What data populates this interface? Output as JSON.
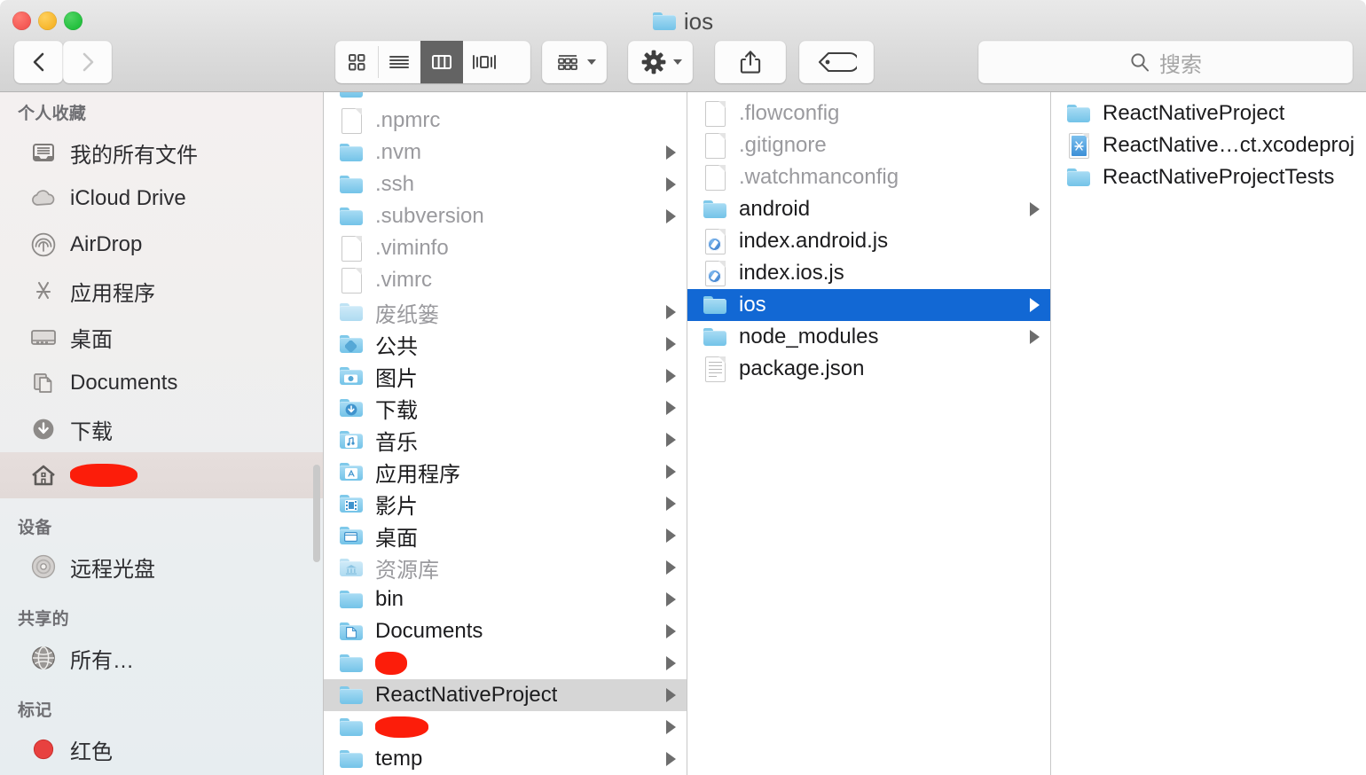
{
  "window": {
    "title": "ios",
    "title_icon": "folder-icon",
    "traffic_lights": [
      {
        "name": "close-button",
        "color": "#f35753"
      },
      {
        "name": "minimize-button",
        "color": "#f6b52b"
      },
      {
        "name": "maximize-button",
        "color": "#23bf3d"
      }
    ]
  },
  "toolbar": {
    "back_label": "‹",
    "forward_label": "›",
    "view_modes": [
      {
        "name": "icon-view-button",
        "icon": "grid-icon",
        "active": false
      },
      {
        "name": "list-view-button",
        "icon": "list-icon",
        "active": false
      },
      {
        "name": "column-view-button",
        "icon": "columns-icon",
        "active": true
      },
      {
        "name": "gallery-view-button",
        "icon": "coverflow-icon",
        "active": false
      }
    ],
    "arrange_label": "arrange-icon",
    "action_label": "gear-icon",
    "share_label": "share-icon",
    "tags_label": "tag-icon"
  },
  "search": {
    "placeholder": "搜索",
    "value": "",
    "icon": "search-icon"
  },
  "sidebar": {
    "sections": [
      {
        "header": "个人收藏",
        "items": [
          {
            "label": "我的所有文件",
            "icon": "all-my-files-icon",
            "selected": false,
            "redacted": false
          },
          {
            "label": "iCloud Drive",
            "icon": "icloud-icon",
            "selected": false,
            "redacted": false
          },
          {
            "label": "AirDrop",
            "icon": "airdrop-icon",
            "selected": false,
            "redacted": false
          },
          {
            "label": "应用程序",
            "icon": "applications-icon",
            "selected": false,
            "redacted": false
          },
          {
            "label": "桌面",
            "icon": "desktop-icon",
            "selected": false,
            "redacted": false
          },
          {
            "label": "Documents",
            "icon": "documents-icon",
            "selected": false,
            "redacted": false
          },
          {
            "label": "下载",
            "icon": "downloads-icon",
            "selected": false,
            "redacted": false
          },
          {
            "label": "",
            "icon": "home-icon",
            "selected": true,
            "redacted": true
          }
        ]
      },
      {
        "header": "设备",
        "items": [
          {
            "label": "远程光盘",
            "icon": "remote-disc-icon",
            "selected": false,
            "redacted": false
          }
        ]
      },
      {
        "header": "共享的",
        "items": [
          {
            "label": "所有…",
            "icon": "network-globe-icon",
            "selected": false,
            "redacted": false
          }
        ]
      },
      {
        "header": "标记",
        "items": [
          {
            "label": "红色",
            "icon": "red-tag-icon",
            "selected": false,
            "redacted": false,
            "color": "#e8413f"
          }
        ]
      }
    ]
  },
  "columns": [
    {
      "name": "home-column",
      "cut_top_row": {
        "label": "",
        "icon": "folder-icon"
      },
      "rows": [
        {
          "label": ".npmrc",
          "icon": "doc-icon",
          "dim": true,
          "arrow": false,
          "state": "none"
        },
        {
          "label": ".nvm",
          "icon": "folder-icon",
          "dim": true,
          "arrow": true,
          "state": "none"
        },
        {
          "label": ".ssh",
          "icon": "folder-icon",
          "dim": true,
          "arrow": true,
          "state": "none"
        },
        {
          "label": ".subversion",
          "icon": "folder-icon",
          "dim": true,
          "arrow": true,
          "state": "none"
        },
        {
          "label": ".viminfo",
          "icon": "doc-icon",
          "dim": true,
          "arrow": false,
          "state": "none"
        },
        {
          "label": ".vimrc",
          "icon": "doc-icon",
          "dim": true,
          "arrow": false,
          "state": "none"
        },
        {
          "label": "废纸篓",
          "icon": "folder-icon",
          "dim": true,
          "arrow": true,
          "state": "none"
        },
        {
          "label": "公共",
          "icon": "public-folder-icon",
          "dim": false,
          "arrow": true,
          "state": "none"
        },
        {
          "label": "图片",
          "icon": "pictures-folder-icon",
          "dim": false,
          "arrow": true,
          "state": "none"
        },
        {
          "label": "下载",
          "icon": "downloads-folder-icon",
          "dim": false,
          "arrow": true,
          "state": "none"
        },
        {
          "label": "音乐",
          "icon": "music-folder-icon",
          "dim": false,
          "arrow": true,
          "state": "none"
        },
        {
          "label": "应用程序",
          "icon": "applications-folder-icon",
          "dim": false,
          "arrow": true,
          "state": "none"
        },
        {
          "label": "影片",
          "icon": "movies-folder-icon",
          "dim": false,
          "arrow": true,
          "state": "none"
        },
        {
          "label": "桌面",
          "icon": "desktop-folder-icon",
          "dim": false,
          "arrow": true,
          "state": "none"
        },
        {
          "label": "资源库",
          "icon": "library-folder-icon",
          "dim": true,
          "arrow": true,
          "state": "none"
        },
        {
          "label": "bin",
          "icon": "folder-icon",
          "dim": false,
          "arrow": true,
          "state": "none"
        },
        {
          "label": "Documents",
          "icon": "documents-folder-icon",
          "dim": false,
          "arrow": true,
          "state": "none"
        },
        {
          "label": "",
          "icon": "folder-icon",
          "dim": false,
          "arrow": true,
          "state": "none",
          "redacted": true
        },
        {
          "label": "ReactNativeProject",
          "icon": "folder-icon",
          "dim": false,
          "arrow": true,
          "state": "grey"
        },
        {
          "label": "",
          "icon": "folder-icon",
          "dim": false,
          "arrow": true,
          "state": "none",
          "redacted": true
        },
        {
          "label": "temp",
          "icon": "folder-icon",
          "dim": false,
          "arrow": true,
          "state": "none"
        }
      ]
    },
    {
      "name": "project-column",
      "rows": [
        {
          "label": ".flowconfig",
          "icon": "doc-icon",
          "dim": true,
          "arrow": false,
          "state": "none"
        },
        {
          "label": ".gitignore",
          "icon": "doc-icon",
          "dim": true,
          "arrow": false,
          "state": "none"
        },
        {
          "label": ".watchmanconfig",
          "icon": "doc-icon",
          "dim": true,
          "arrow": false,
          "state": "none"
        },
        {
          "label": "android",
          "icon": "folder-icon",
          "dim": false,
          "arrow": true,
          "state": "none"
        },
        {
          "label": "index.android.js",
          "icon": "js-doc-icon",
          "dim": false,
          "arrow": false,
          "state": "none"
        },
        {
          "label": "index.ios.js",
          "icon": "js-doc-icon",
          "dim": false,
          "arrow": false,
          "state": "none"
        },
        {
          "label": "ios",
          "icon": "folder-icon",
          "dim": false,
          "arrow": true,
          "state": "blue"
        },
        {
          "label": "node_modules",
          "icon": "folder-icon",
          "dim": false,
          "arrow": true,
          "state": "none"
        },
        {
          "label": "package.json",
          "icon": "text-doc-icon",
          "dim": false,
          "arrow": false,
          "state": "none"
        }
      ]
    },
    {
      "name": "ios-column",
      "rows": [
        {
          "label": "ReactNativeProject",
          "icon": "folder-icon",
          "dim": false,
          "arrow": false,
          "state": "none"
        },
        {
          "label": "ReactNative…ct.xcodeproj",
          "icon": "xcodeproj-icon",
          "dim": false,
          "arrow": false,
          "state": "none"
        },
        {
          "label": "ReactNativeProjectTests",
          "icon": "folder-icon",
          "dim": false,
          "arrow": false,
          "state": "none"
        }
      ]
    }
  ],
  "colors": {
    "selection_blue": "#1268d4",
    "selection_grey": "#d6d6d6",
    "sidebar_selected": "#e4dcda",
    "folder_blue": "#73c3e8",
    "redaction_red": "#fc1d0a"
  }
}
